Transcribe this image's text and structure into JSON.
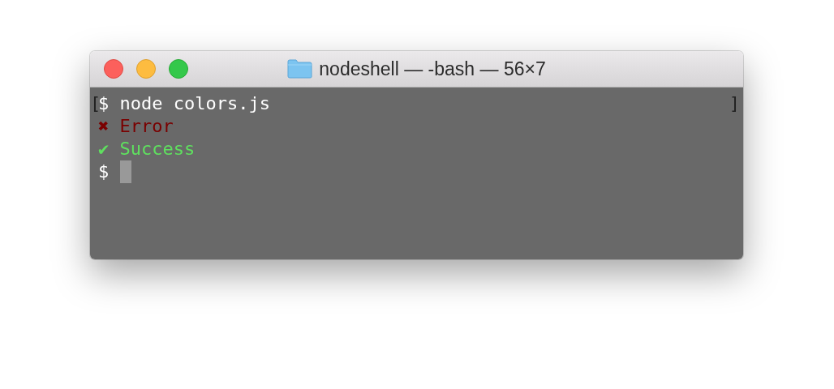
{
  "window": {
    "title": "nodeshell — -bash — 56×7"
  },
  "terminal": {
    "mark_open": "[",
    "mark_close": "]",
    "lines": [
      {
        "kind": "command",
        "prompt": "$",
        "text": "node colors.js",
        "color": "#ffffff"
      },
      {
        "kind": "status",
        "symbol": "✖",
        "text": "Error",
        "color": "#7a0000"
      },
      {
        "kind": "status",
        "symbol": "✔",
        "text": "Success",
        "color": "#5fe05f"
      },
      {
        "kind": "input",
        "prompt": "$",
        "cursor": true,
        "color": "#ffffff"
      }
    ]
  }
}
